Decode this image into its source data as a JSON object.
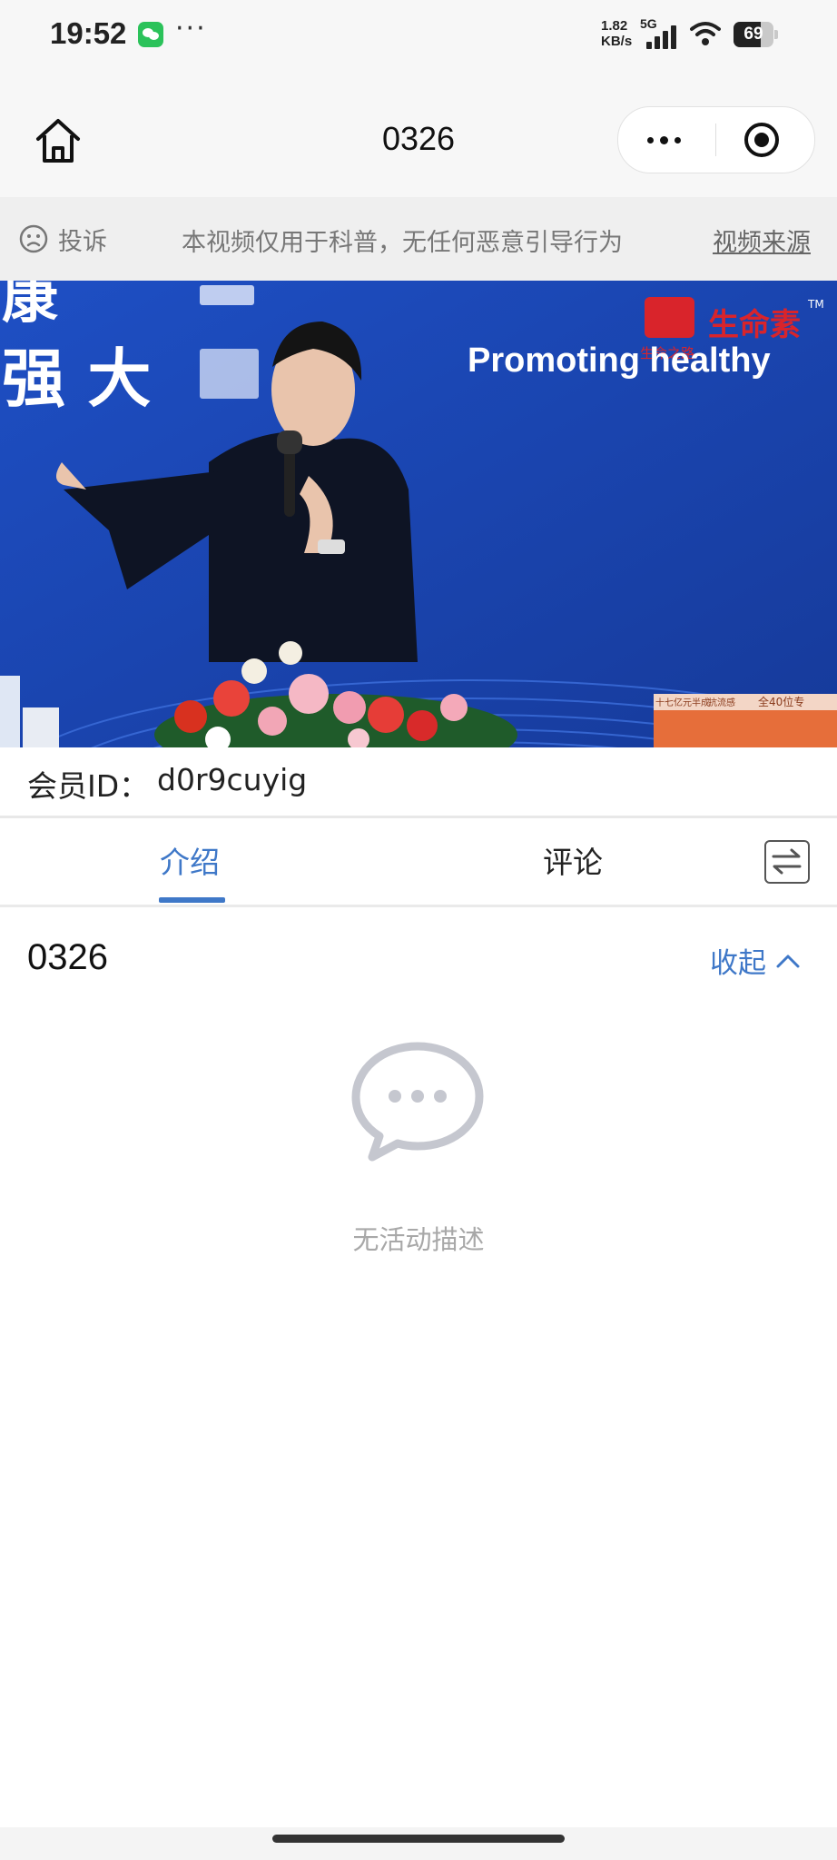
{
  "status_bar": {
    "time": "19:52",
    "dots": "···",
    "net_speed_value": "1.82",
    "net_speed_unit": "KB/s",
    "network": "5G",
    "battery": "69",
    "battery_level": 0.69
  },
  "nav": {
    "title": "0326",
    "home_icon": "home-icon",
    "more_icon": "more-dots-icon",
    "close_icon": "target-close-icon"
  },
  "notice": {
    "complain_label": "投诉",
    "text": "本视频仅用于科普，无任何恶意引导行为",
    "source_link": "视频来源"
  },
  "video": {
    "banner_text_left_top": "康",
    "banner_text_left": "强 大",
    "banner_text_right": "Promoting healthy",
    "brand": "生命素",
    "brand_tm": "TM",
    "brand_sub": "生命之路",
    "box_text_1": "十七亿元半成",
    "box_text_2": "抗流感",
    "box_text_3": "全40位专"
  },
  "member": {
    "label": "会员ID：",
    "value": "d0r9cuyig"
  },
  "tabs": [
    {
      "label": "介绍",
      "active": true
    },
    {
      "label": "评论",
      "active": false
    }
  ],
  "content": {
    "title": "0326",
    "collapse_label": "收起",
    "empty_text": "无活动描述"
  },
  "colors": {
    "accent": "#3f78c8",
    "video_bg": "#1c47b8",
    "brand_red": "#d9242b"
  }
}
